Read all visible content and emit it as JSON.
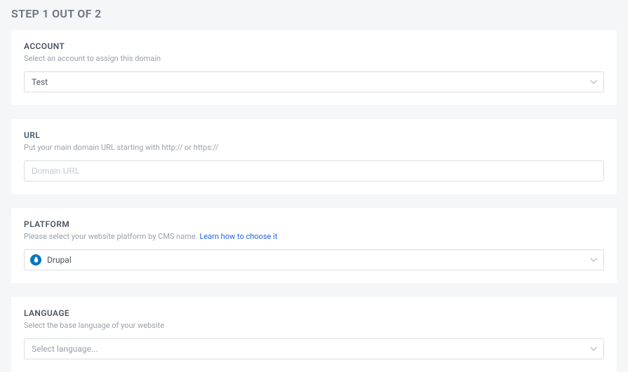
{
  "header": {
    "title": "STEP 1 OUT OF 2"
  },
  "account": {
    "label": "ACCOUNT",
    "description": "Select an account to assign this domain",
    "value": "Test"
  },
  "url": {
    "label": "URL",
    "description": "Put your main domain URL starting with http:// or https://",
    "placeholder": "Domain URL"
  },
  "platform": {
    "label": "PLATFORM",
    "description_pre": "Please select your website platform by CMS name.  ",
    "link_text": "Learn how to choose it",
    "value": "Drupal",
    "icon": "drupal-icon"
  },
  "language": {
    "label": "LANGUAGE",
    "description": "Select the base language of your website",
    "placeholder": "Select language..."
  }
}
